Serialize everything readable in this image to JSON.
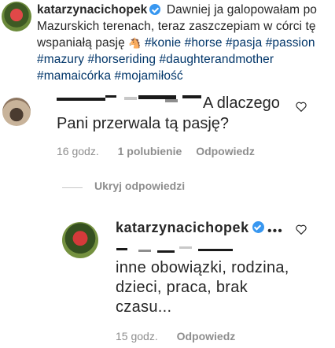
{
  "caption": {
    "username": "katarzynacichopek",
    "text_line1": "Dawniej ja galopowałam po",
    "text_line2": "Mazurskich terenach, teraz zaszczepiam w córci tę",
    "text_line3": "wspaniałą pasję",
    "horse_emoji": "🐴",
    "hashtags_line3": "#konie #horse #pasja #passion",
    "hashtags_line4": "#mazury #horseriding #daughterandmother",
    "hashtags_line5": "#mamaicórka #mojamiłość"
  },
  "comment": {
    "text_part1": "A dlaczego",
    "text_part2": "Pani przerwala tą pasję?",
    "time": "16 godz.",
    "likes": "1 polubienie",
    "reply_label": "Odpowiedz",
    "heart_icon": "heart-outline-icon"
  },
  "replies_toggle": {
    "label": "Ukryj odpowiedzi"
  },
  "reply": {
    "username": "katarzynacichopek",
    "more_label": "•••",
    "text": "inne obowiązki, rodzina, dzieci, praca, brak czasu...",
    "time": "15 godz.",
    "reply_label": "Odpowiedz",
    "heart_icon": "heart-outline-icon"
  },
  "colors": {
    "text": "#262626",
    "muted": "#8e8e8e",
    "hashtag": "#003569",
    "verified": "#3897f0"
  }
}
